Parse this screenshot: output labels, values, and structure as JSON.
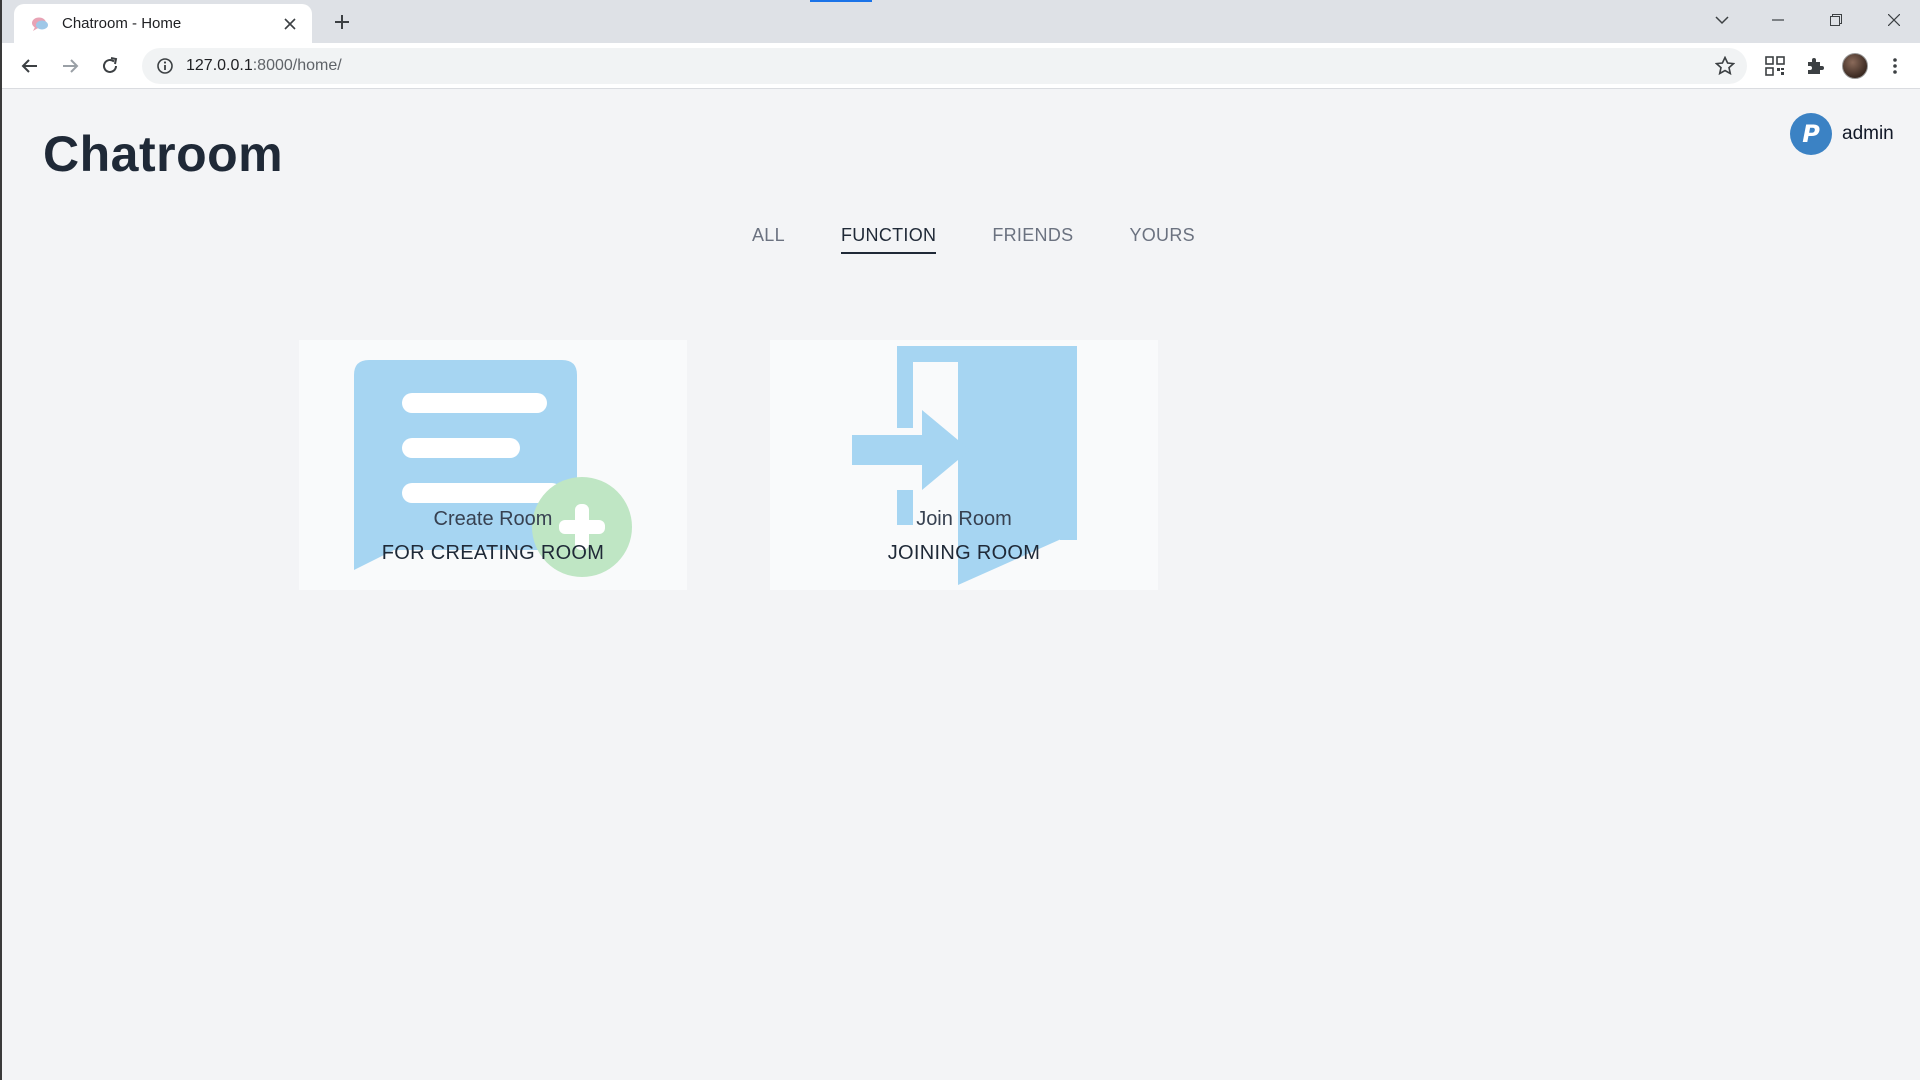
{
  "browser": {
    "tab_title": "Chatroom - Home",
    "url_host": "127.0.0.1",
    "url_path": ":8000/home/"
  },
  "header": {
    "title": "Chatroom",
    "username": "admin",
    "avatar_letter": "P"
  },
  "nav_tabs": [
    {
      "label": "ALL"
    },
    {
      "label": "FUNCTION"
    },
    {
      "label": "FRIENDS"
    },
    {
      "label": "YOURS"
    }
  ],
  "active_tab": "FUNCTION",
  "cards": [
    {
      "title": "Create Room",
      "subtitle": "FOR CREATING ROOM",
      "icon": "chat-plus-icon"
    },
    {
      "title": "Join Room",
      "subtitle": "JOINING ROOM",
      "icon": "door-enter-icon"
    }
  ],
  "colors": {
    "illustration_blue": "#a6d5f2",
    "illustration_green": "#bfe6c4",
    "title_text": "#1f2937",
    "avatar_blue": "#3b82c4"
  }
}
